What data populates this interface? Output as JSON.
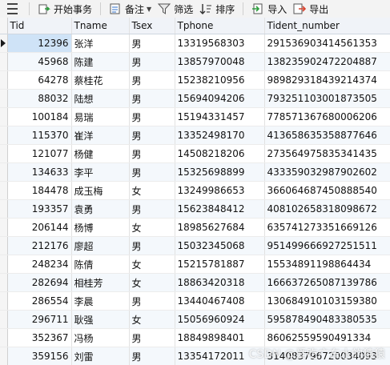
{
  "toolbar": {
    "begin_transaction": "开始事务",
    "remark": "备注",
    "filter": "筛选",
    "sort": "排序",
    "import": "导入",
    "export": "导出"
  },
  "table": {
    "columns": [
      "Tid",
      "Tname",
      "Tsex",
      "Tphone",
      "Tident_number"
    ],
    "rows": [
      [
        "12396",
        "张洋",
        "男",
        "13319568303",
        "291536903414561353"
      ],
      [
        "45968",
        "陈建",
        "男",
        "13857970048",
        "138235902472204887"
      ],
      [
        "64278",
        "蔡桂花",
        "男",
        "15238210956",
        "989829318439214374"
      ],
      [
        "88032",
        "陆想",
        "男",
        "15694094206",
        "793251103001873505"
      ],
      [
        "100184",
        "易瑞",
        "男",
        "15194331457",
        "778571367680006206"
      ],
      [
        "115370",
        "崔洋",
        "男",
        "13352498170",
        "413658635358877646"
      ],
      [
        "121077",
        "杨健",
        "男",
        "14508218206",
        "273564975835341435"
      ],
      [
        "134633",
        "李平",
        "男",
        "15325698899",
        "433359032987902602"
      ],
      [
        "184478",
        "成玉梅",
        "女",
        "13249986653",
        "366064687450888540"
      ],
      [
        "193357",
        "袁勇",
        "男",
        "15623848412",
        "408102658318098672"
      ],
      [
        "206144",
        "杨博",
        "女",
        "18985627684",
        "635741273351669126"
      ],
      [
        "212176",
        "廖超",
        "男",
        "15032345068",
        "951499666927251511"
      ],
      [
        "248234",
        "陈倩",
        "女",
        "15215781887",
        "15534891198864434"
      ],
      [
        "282694",
        "相桂芳",
        "女",
        "18863420318",
        "166637265087139786"
      ],
      [
        "286554",
        "李晨",
        "男",
        "13440467408",
        "130684910103159380"
      ],
      [
        "296711",
        "耿强",
        "女",
        "15056960924",
        "595878490483380535"
      ],
      [
        "352367",
        "冯杨",
        "男",
        "18849898401",
        "86062559590491334"
      ],
      [
        "359156",
        "刘雷",
        "男",
        "13354172011",
        "314083796720034093"
      ]
    ]
  },
  "watermark": "CSDN @爱吃广东水的猿猿",
  "colors": {
    "header_bg": "#f0f3f8",
    "alt_row_bg": "#f4f8fc",
    "selected_cell_bg": "#cfe3f7",
    "icon_green": "#2e9e3e",
    "icon_blue": "#2f6fc9"
  }
}
